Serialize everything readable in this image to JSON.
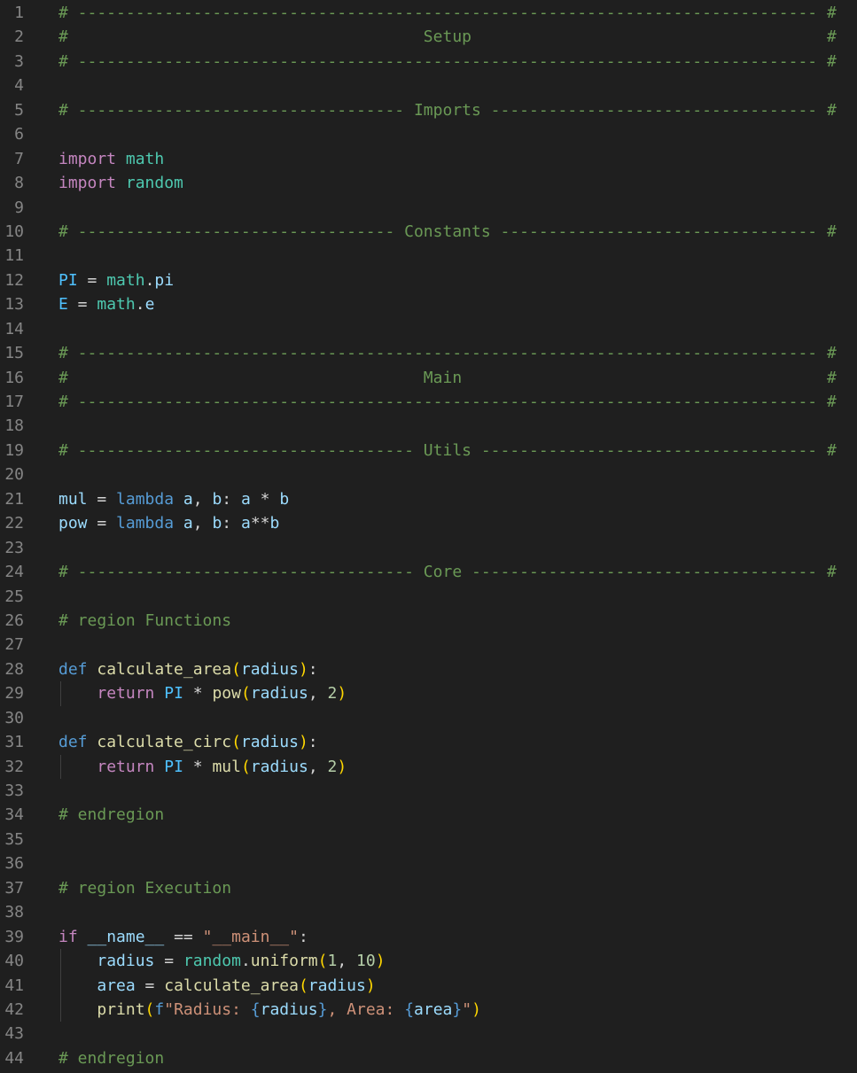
{
  "editor": {
    "language": "python",
    "theme_colors": {
      "background": "#1f1f1f",
      "line_number": "#858585",
      "comment": "#6a9955",
      "keyword": "#c586c0",
      "definition": "#569cd6",
      "module": "#4ec9b0",
      "variable": "#9cdcfe",
      "constant": "#4fc1ff",
      "function": "#dcdcaa",
      "number": "#b5cea8",
      "string": "#ce9178",
      "bracket_level_1": "#ffd700",
      "bracket_level_2": "#da70d6",
      "bracket_level_3": "#179fff"
    },
    "lines": [
      {
        "n": "1",
        "indent_guide": false,
        "tokens": [
          {
            "t": "# ----------------------------------------------------------------------------- #",
            "c": "comment"
          }
        ]
      },
      {
        "n": "2",
        "indent_guide": false,
        "tokens": [
          {
            "t": "#                                     Setup                                     #",
            "c": "comment"
          }
        ]
      },
      {
        "n": "3",
        "indent_guide": false,
        "tokens": [
          {
            "t": "# ----------------------------------------------------------------------------- #",
            "c": "comment"
          }
        ]
      },
      {
        "n": "4",
        "indent_guide": false,
        "tokens": []
      },
      {
        "n": "5",
        "indent_guide": false,
        "tokens": [
          {
            "t": "# ---------------------------------- Imports ---------------------------------- #",
            "c": "comment"
          }
        ]
      },
      {
        "n": "6",
        "indent_guide": false,
        "tokens": []
      },
      {
        "n": "7",
        "indent_guide": false,
        "tokens": [
          {
            "t": "import",
            "c": "kw"
          },
          {
            "t": " ",
            "c": "op"
          },
          {
            "t": "math",
            "c": "mod"
          }
        ]
      },
      {
        "n": "8",
        "indent_guide": false,
        "tokens": [
          {
            "t": "import",
            "c": "kw"
          },
          {
            "t": " ",
            "c": "op"
          },
          {
            "t": "random",
            "c": "mod"
          }
        ]
      },
      {
        "n": "9",
        "indent_guide": false,
        "tokens": []
      },
      {
        "n": "10",
        "indent_guide": false,
        "tokens": [
          {
            "t": "# --------------------------------- Constants --------------------------------- #",
            "c": "comment"
          }
        ]
      },
      {
        "n": "11",
        "indent_guide": false,
        "tokens": []
      },
      {
        "n": "12",
        "indent_guide": false,
        "tokens": [
          {
            "t": "PI",
            "c": "const"
          },
          {
            "t": " = ",
            "c": "op"
          },
          {
            "t": "math",
            "c": "mod"
          },
          {
            "t": ".",
            "c": "op"
          },
          {
            "t": "pi",
            "c": "var"
          }
        ]
      },
      {
        "n": "13",
        "indent_guide": false,
        "tokens": [
          {
            "t": "E",
            "c": "const"
          },
          {
            "t": " = ",
            "c": "op"
          },
          {
            "t": "math",
            "c": "mod"
          },
          {
            "t": ".",
            "c": "op"
          },
          {
            "t": "e",
            "c": "var"
          }
        ]
      },
      {
        "n": "14",
        "indent_guide": false,
        "tokens": []
      },
      {
        "n": "15",
        "indent_guide": false,
        "tokens": [
          {
            "t": "# ----------------------------------------------------------------------------- #",
            "c": "comment"
          }
        ]
      },
      {
        "n": "16",
        "indent_guide": false,
        "tokens": [
          {
            "t": "#                                     Main                                      #",
            "c": "comment"
          }
        ]
      },
      {
        "n": "17",
        "indent_guide": false,
        "tokens": [
          {
            "t": "# ----------------------------------------------------------------------------- #",
            "c": "comment"
          }
        ]
      },
      {
        "n": "18",
        "indent_guide": false,
        "tokens": []
      },
      {
        "n": "19",
        "indent_guide": false,
        "tokens": [
          {
            "t": "# ----------------------------------- Utils ----------------------------------- #",
            "c": "comment"
          }
        ]
      },
      {
        "n": "20",
        "indent_guide": false,
        "tokens": []
      },
      {
        "n": "21",
        "indent_guide": false,
        "tokens": [
          {
            "t": "mul",
            "c": "var"
          },
          {
            "t": " = ",
            "c": "op"
          },
          {
            "t": "lambda",
            "c": "def"
          },
          {
            "t": " ",
            "c": "op"
          },
          {
            "t": "a",
            "c": "var"
          },
          {
            "t": ", ",
            "c": "op"
          },
          {
            "t": "b",
            "c": "var"
          },
          {
            "t": ": ",
            "c": "op"
          },
          {
            "t": "a",
            "c": "var"
          },
          {
            "t": " * ",
            "c": "op"
          },
          {
            "t": "b",
            "c": "var"
          }
        ]
      },
      {
        "n": "22",
        "indent_guide": false,
        "tokens": [
          {
            "t": "pow",
            "c": "var"
          },
          {
            "t": " = ",
            "c": "op"
          },
          {
            "t": "lambda",
            "c": "def"
          },
          {
            "t": " ",
            "c": "op"
          },
          {
            "t": "a",
            "c": "var"
          },
          {
            "t": ", ",
            "c": "op"
          },
          {
            "t": "b",
            "c": "var"
          },
          {
            "t": ": ",
            "c": "op"
          },
          {
            "t": "a",
            "c": "var"
          },
          {
            "t": "**",
            "c": "op"
          },
          {
            "t": "b",
            "c": "var"
          }
        ]
      },
      {
        "n": "23",
        "indent_guide": false,
        "tokens": []
      },
      {
        "n": "24",
        "indent_guide": false,
        "tokens": [
          {
            "t": "# ----------------------------------- Core ------------------------------------ #",
            "c": "comment"
          }
        ]
      },
      {
        "n": "25",
        "indent_guide": false,
        "tokens": []
      },
      {
        "n": "26",
        "indent_guide": false,
        "tokens": [
          {
            "t": "# region Functions",
            "c": "comment"
          }
        ]
      },
      {
        "n": "27",
        "indent_guide": false,
        "tokens": []
      },
      {
        "n": "28",
        "indent_guide": false,
        "tokens": [
          {
            "t": "def",
            "c": "def"
          },
          {
            "t": " ",
            "c": "op"
          },
          {
            "t": "calculate_area",
            "c": "fn"
          },
          {
            "t": "(",
            "c": "p1"
          },
          {
            "t": "radius",
            "c": "var"
          },
          {
            "t": ")",
            "c": "p1"
          },
          {
            "t": ":",
            "c": "op"
          }
        ]
      },
      {
        "n": "29",
        "indent_guide": true,
        "tokens": [
          {
            "t": "    ",
            "c": "op"
          },
          {
            "t": "return",
            "c": "kw"
          },
          {
            "t": " ",
            "c": "op"
          },
          {
            "t": "PI",
            "c": "const"
          },
          {
            "t": " * ",
            "c": "op"
          },
          {
            "t": "pow",
            "c": "fn"
          },
          {
            "t": "(",
            "c": "p1"
          },
          {
            "t": "radius",
            "c": "var"
          },
          {
            "t": ", ",
            "c": "op"
          },
          {
            "t": "2",
            "c": "num"
          },
          {
            "t": ")",
            "c": "p1"
          }
        ]
      },
      {
        "n": "30",
        "indent_guide": false,
        "tokens": []
      },
      {
        "n": "31",
        "indent_guide": false,
        "tokens": [
          {
            "t": "def",
            "c": "def"
          },
          {
            "t": " ",
            "c": "op"
          },
          {
            "t": "calculate_circ",
            "c": "fn"
          },
          {
            "t": "(",
            "c": "p1"
          },
          {
            "t": "radius",
            "c": "var"
          },
          {
            "t": ")",
            "c": "p1"
          },
          {
            "t": ":",
            "c": "op"
          }
        ]
      },
      {
        "n": "32",
        "indent_guide": true,
        "tokens": [
          {
            "t": "    ",
            "c": "op"
          },
          {
            "t": "return",
            "c": "kw"
          },
          {
            "t": " ",
            "c": "op"
          },
          {
            "t": "PI",
            "c": "const"
          },
          {
            "t": " * ",
            "c": "op"
          },
          {
            "t": "mul",
            "c": "fn"
          },
          {
            "t": "(",
            "c": "p1"
          },
          {
            "t": "radius",
            "c": "var"
          },
          {
            "t": ", ",
            "c": "op"
          },
          {
            "t": "2",
            "c": "num"
          },
          {
            "t": ")",
            "c": "p1"
          }
        ]
      },
      {
        "n": "33",
        "indent_guide": false,
        "tokens": []
      },
      {
        "n": "34",
        "indent_guide": false,
        "tokens": [
          {
            "t": "# endregion",
            "c": "comment"
          }
        ]
      },
      {
        "n": "35",
        "indent_guide": false,
        "tokens": []
      },
      {
        "n": "36",
        "indent_guide": false,
        "tokens": []
      },
      {
        "n": "37",
        "indent_guide": false,
        "tokens": [
          {
            "t": "# region Execution",
            "c": "comment"
          }
        ]
      },
      {
        "n": "38",
        "indent_guide": false,
        "tokens": []
      },
      {
        "n": "39",
        "indent_guide": false,
        "tokens": [
          {
            "t": "if",
            "c": "kw"
          },
          {
            "t": " ",
            "c": "op"
          },
          {
            "t": "__name__",
            "c": "var"
          },
          {
            "t": " == ",
            "c": "op"
          },
          {
            "t": "\"__main__\"",
            "c": "str"
          },
          {
            "t": ":",
            "c": "op"
          }
        ]
      },
      {
        "n": "40",
        "indent_guide": true,
        "tokens": [
          {
            "t": "    ",
            "c": "op"
          },
          {
            "t": "radius",
            "c": "var"
          },
          {
            "t": " = ",
            "c": "op"
          },
          {
            "t": "random",
            "c": "mod"
          },
          {
            "t": ".",
            "c": "op"
          },
          {
            "t": "uniform",
            "c": "fn"
          },
          {
            "t": "(",
            "c": "p1"
          },
          {
            "t": "1",
            "c": "num"
          },
          {
            "t": ", ",
            "c": "op"
          },
          {
            "t": "10",
            "c": "num"
          },
          {
            "t": ")",
            "c": "p1"
          }
        ]
      },
      {
        "n": "41",
        "indent_guide": true,
        "tokens": [
          {
            "t": "    ",
            "c": "op"
          },
          {
            "t": "area",
            "c": "var"
          },
          {
            "t": " = ",
            "c": "op"
          },
          {
            "t": "calculate_area",
            "c": "fn"
          },
          {
            "t": "(",
            "c": "p1"
          },
          {
            "t": "radius",
            "c": "var"
          },
          {
            "t": ")",
            "c": "p1"
          }
        ]
      },
      {
        "n": "42",
        "indent_guide": true,
        "tokens": [
          {
            "t": "    ",
            "c": "op"
          },
          {
            "t": "print",
            "c": "fn"
          },
          {
            "t": "(",
            "c": "p1"
          },
          {
            "t": "f",
            "c": "def"
          },
          {
            "t": "\"Radius: ",
            "c": "str"
          },
          {
            "t": "{",
            "c": "brace"
          },
          {
            "t": "radius",
            "c": "var"
          },
          {
            "t": "}",
            "c": "brace"
          },
          {
            "t": ", Area: ",
            "c": "str"
          },
          {
            "t": "{",
            "c": "brace"
          },
          {
            "t": "area",
            "c": "var"
          },
          {
            "t": "}",
            "c": "brace"
          },
          {
            "t": "\"",
            "c": "str"
          },
          {
            "t": ")",
            "c": "p1"
          }
        ]
      },
      {
        "n": "43",
        "indent_guide": false,
        "tokens": []
      },
      {
        "n": "44",
        "indent_guide": false,
        "tokens": [
          {
            "t": "# endregion",
            "c": "comment"
          }
        ]
      }
    ]
  }
}
